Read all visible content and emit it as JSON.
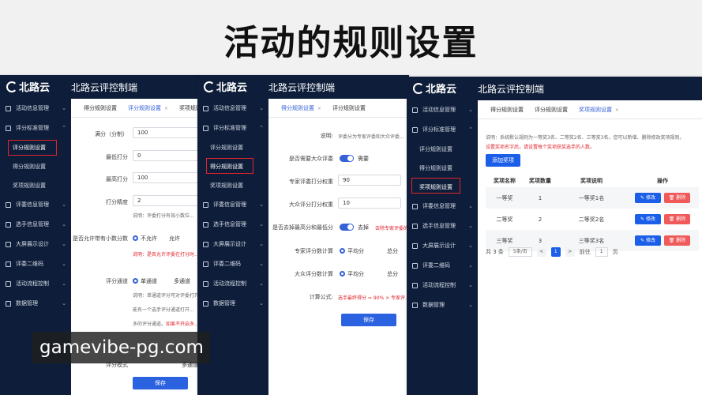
{
  "page_title": "活动的规则设置",
  "brand": {
    "logo": "北路云",
    "app_title": "北路云评控制端"
  },
  "sidebar": {
    "items": [
      "活动信息管理",
      "评分标准管理",
      "评委信息管理",
      "选手信息管理",
      "大屏展示设计",
      "评委二维码",
      "活动流程控制",
      "数据管理"
    ],
    "sub_items": [
      "评分规则设置",
      "得分规则设置",
      "奖项规则设置"
    ]
  },
  "tabs": {
    "score_rules": "得分规则设置",
    "scoring_rules": "评分规则设置",
    "award_rules": "奖项规则设置"
  },
  "panel1": {
    "fields": [
      {
        "label": "满分（分制）",
        "value": "100"
      },
      {
        "label": "最低打分",
        "value": "0"
      },
      {
        "label": "最高打分",
        "value": "100"
      },
      {
        "label": "打分精度",
        "value": "2"
      }
    ],
    "precision_hint": "说明：评委打分有效小数位...",
    "decimal_label": "是否允许带有小数分数",
    "decimal_no": "不允许",
    "decimal_yes": "允许",
    "decimal_hint": "说明：是否允许评委在打分时...",
    "channel_label": "评分通道",
    "channel_single": "单通道",
    "channel_multi": "多通道",
    "channel_hint1": "说明：单通道评分可对评委打开...",
    "channel_hint2": "能有一个选手评分通道打开...",
    "channel_hint3": "多的评分通道。",
    "channel_hint3_red": "如果不开启多...",
    "mode_label": "评分模式",
    "mode_value": "多通道",
    "save": "保存"
  },
  "panel2": {
    "desc_label": "说明:",
    "desc_text": "评委分为专家评委和大众评委...",
    "public_label": "是否需要大众评委",
    "public_on_text": "需要",
    "expert_weight_label": "专家评委打分权重",
    "expert_weight": "90",
    "public_weight_label": "大众评分打分权重",
    "public_weight": "10",
    "trim_label": "是否去掉最高分和最低分",
    "trim_value": "去掉",
    "trim_hint": "去除专家评委的最...",
    "expert_calc_label": "专家评分数计算",
    "public_calc_label": "大众评分数计算",
    "calc_avg": "平均分",
    "calc_total": "总分",
    "formula_label": "计算公式:",
    "formula_text": "选手最终得分 = 90% × 专家评...",
    "save": "保存"
  },
  "panel3": {
    "desc": "说明：系统默认规则为一等奖3名、二等奖2名、三等奖3名。您可以新增、删除修改奖项规则。",
    "desc_red": "设置奖项名字后，请设置每个奖项获奖选手的人数。",
    "add_button": "添加奖项",
    "columns": [
      "奖项名称",
      "奖项数量",
      "奖项说明",
      "操作"
    ],
    "rows": [
      {
        "name": "一等奖",
        "count": "1",
        "desc": "一等奖1名"
      },
      {
        "name": "二等奖",
        "count": "2",
        "desc": "二等奖2名"
      },
      {
        "name": "三等奖",
        "count": "3",
        "desc": "三等奖3名"
      }
    ],
    "edit": "修改",
    "delete": "删除",
    "pager": {
      "total": "共 3 条",
      "size": "5条/页",
      "prev": "<",
      "page": "1",
      "next": ">",
      "goto": "前往",
      "input": "1",
      "unit": "页"
    }
  },
  "watermark": "gamevibe-pg.com",
  "colors": {
    "sidebar": "#0e1e3a",
    "accent": "#1b5ee8",
    "danger": "#f05a5a",
    "highlight": "#e0242d"
  }
}
